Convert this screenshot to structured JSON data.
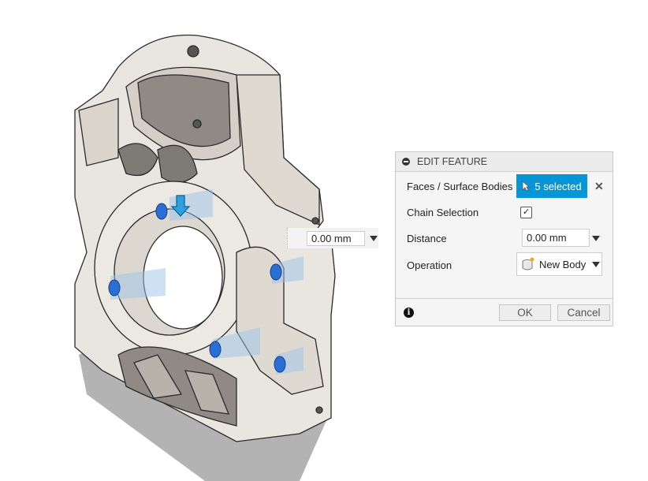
{
  "dialog": {
    "title": "EDIT FEATURE",
    "faces_label": "Faces / Surface Bodies",
    "faces_value": "5 selected",
    "chain_label": "Chain Selection",
    "chain_checked": true,
    "distance_label": "Distance",
    "distance_value": "0.00 mm",
    "operation_label": "Operation",
    "operation_value": "New Body",
    "ok": "OK",
    "cancel": "Cancel",
    "accent": "#0696d7"
  },
  "canvas": {
    "distance_manipulator_value": "0.00 mm"
  }
}
